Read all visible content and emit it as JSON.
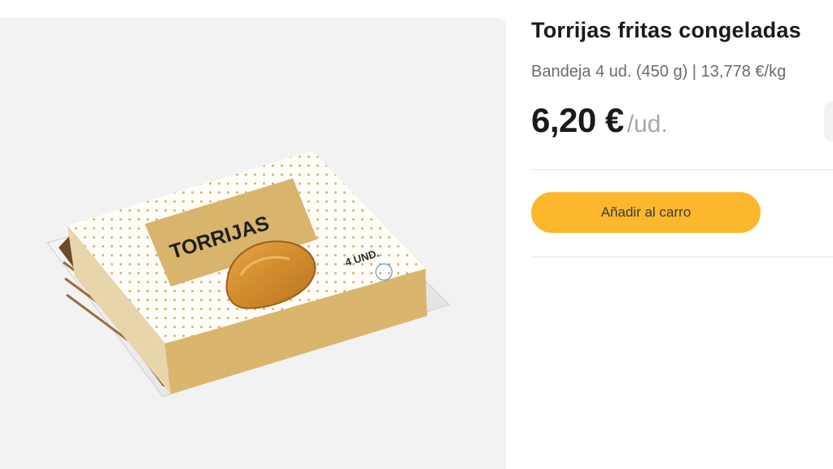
{
  "product": {
    "name": "Torrijas fritas congeladas",
    "package_info": "Bandeja 4 ud. (450 g) | 13,778 €/kg",
    "price": "6,20 €",
    "price_unit": "/ud.",
    "image": {
      "label": "TORRIJAS",
      "count_label": "4 UND."
    }
  },
  "actions": {
    "add_to_cart_label": "Añadir al carro"
  },
  "colors": {
    "accent": "#fcb72c",
    "image_background": "#f2f2f2",
    "package_gold": "#d8b46c",
    "text_dark": "#1a1a1a",
    "text_muted": "#6b6b6b"
  }
}
